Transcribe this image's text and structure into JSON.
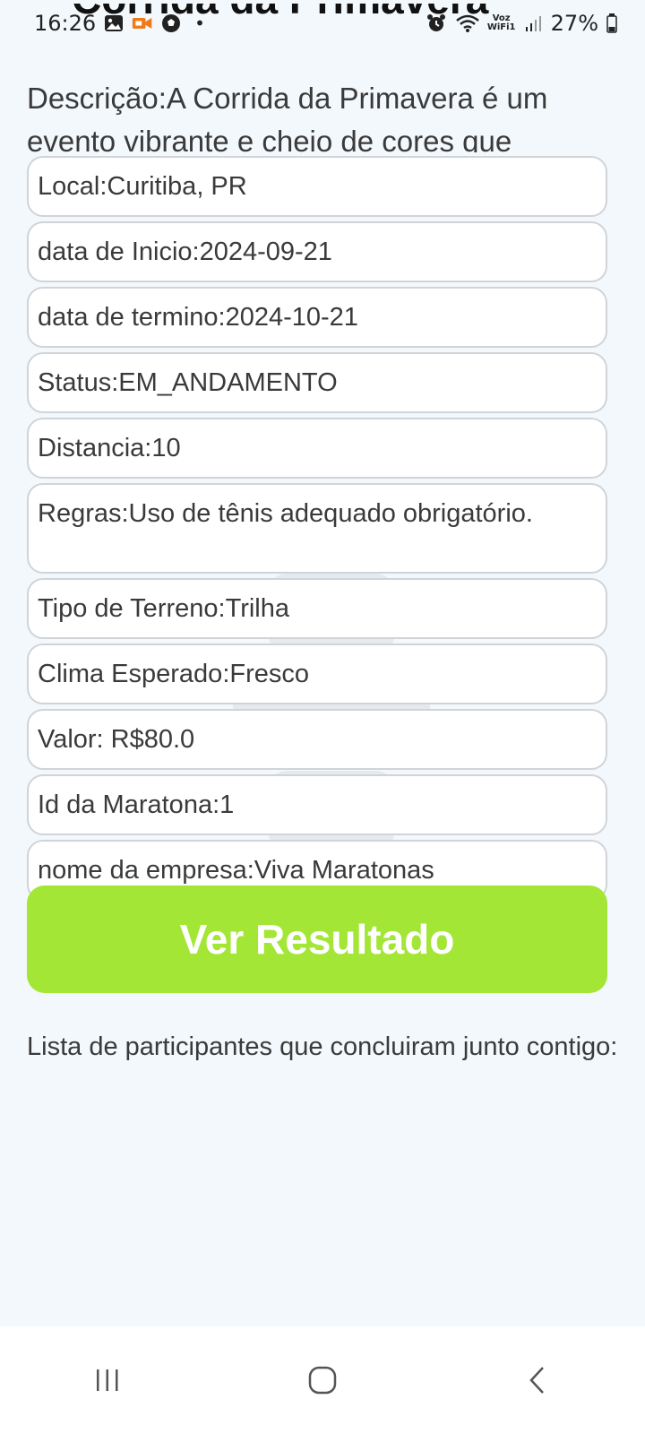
{
  "status_bar": {
    "time": "16:26",
    "battery": "27%",
    "dot": "•",
    "voz_wifi_line1": "Voz",
    "voz_wifi_line2": "WiFi1"
  },
  "event": {
    "title": "Corrida da Primavera",
    "description": "Descrição:A Corrida da Primavera é um evento vibrante e cheio de cores que"
  },
  "fields": [
    {
      "name": "field-local",
      "text": "Local:Curitiba, PR"
    },
    {
      "name": "field-start-date",
      "text": "data de Inicio:2024-09-21"
    },
    {
      "name": "field-end-date",
      "text": "data de termino:2024-10-21"
    },
    {
      "name": "field-status",
      "text": "Status:EM_ANDAMENTO"
    },
    {
      "name": "field-distance",
      "text": "Distancia:10"
    },
    {
      "name": "field-rules",
      "text": "Regras:Uso de tênis adequado obrigatório."
    },
    {
      "name": "field-terrain",
      "text": "Tipo de Terreno:Trilha"
    },
    {
      "name": "field-climate",
      "text": "Clima Esperado:Fresco"
    },
    {
      "name": "field-price",
      "text": "Valor: R$80.0"
    },
    {
      "name": "field-marathon-id",
      "text": "Id da Maratona:1"
    },
    {
      "name": "field-company",
      "text": "nome da empresa:Viva Maratonas"
    }
  ],
  "actions": {
    "view_result_label": "Ver Resultado"
  },
  "participants": {
    "heading": "Lista de participantes que concluiram junto contigo:"
  },
  "colors": {
    "background": "#f3f8fc",
    "button": "#a3e636",
    "field_border": "#d0d4d8"
  },
  "icons": {
    "status_left": [
      "image-icon",
      "video-recorder-icon",
      "soccer-ball-icon"
    ],
    "status_right": [
      "alarm-icon",
      "wifi-icon",
      "voz-wifi-icon",
      "signal-icon",
      "battery-icon"
    ],
    "nav": [
      "recent-apps-icon",
      "home-icon",
      "back-icon"
    ]
  }
}
